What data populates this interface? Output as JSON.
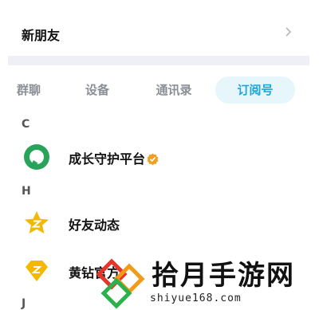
{
  "new_friends": {
    "label": "新朋友"
  },
  "tabs": [
    {
      "label": "群聊"
    },
    {
      "label": "设备"
    },
    {
      "label": "通讯录"
    },
    {
      "label": "订阅号",
      "active": true
    }
  ],
  "sections": [
    {
      "letter": "C",
      "items": [
        {
          "name": "成长守护平台",
          "verified": true
        }
      ]
    },
    {
      "letter": "H",
      "items": [
        {
          "name": "好友动态"
        },
        {
          "name": "黄钻官方"
        }
      ]
    },
    {
      "letter": "J"
    }
  ],
  "watermark": {
    "site_name": "拾月手游网",
    "url": "shiyue168.com"
  },
  "colors": {
    "accent": "#1aa7d8",
    "active_tab_bg": "#e6f6fb",
    "green": "#27a35a",
    "gold": "#f5b800"
  }
}
